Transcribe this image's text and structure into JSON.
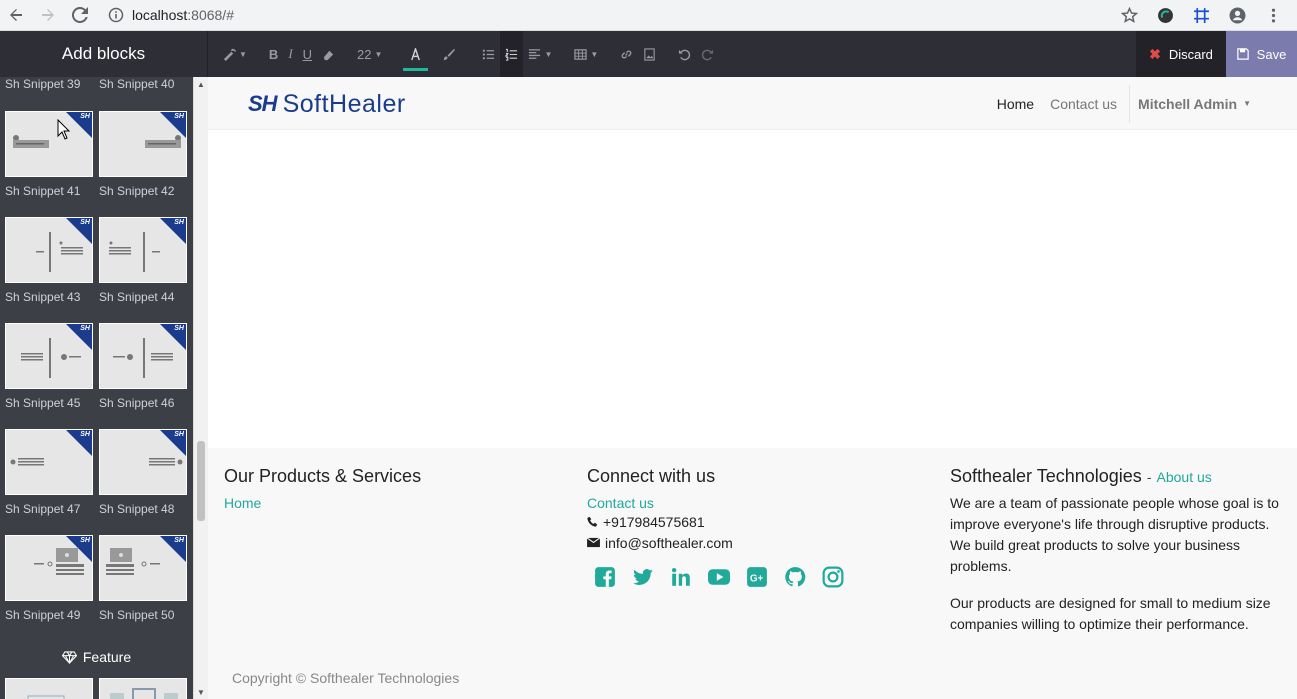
{
  "browser": {
    "url_host": "localhost",
    "url_rest": ":8068/#"
  },
  "editor": {
    "panel_title": "Add blocks",
    "font_size": "22",
    "discard_label": "Discard",
    "save_label": "Save"
  },
  "snippets": {
    "top_labels": [
      "Sh Snippet 39",
      "Sh Snippet 40"
    ],
    "rows": [
      {
        "left": "Sh Snippet 41",
        "right": "Sh Snippet 42"
      },
      {
        "left": "Sh Snippet 43",
        "right": "Sh Snippet 44"
      },
      {
        "left": "Sh Snippet 45",
        "right": "Sh Snippet 46"
      },
      {
        "left": "Sh Snippet 47",
        "right": "Sh Snippet 48"
      },
      {
        "left": "Sh Snippet 49",
        "right": "Sh Snippet 50"
      }
    ],
    "badge": "SH",
    "feature_label": "Feature"
  },
  "site": {
    "logo_text": "SoftHealer",
    "logo_mark": "SH",
    "nav": {
      "home": "Home",
      "contact": "Contact us",
      "user": "Mitchell Admin"
    }
  },
  "footer": {
    "col1": {
      "title": "Our Products & Services",
      "link": "Home"
    },
    "col2": {
      "title": "Connect with us",
      "link": "Contact us",
      "phone": "+917984575681",
      "email": "info@softhealer.com",
      "social": [
        "facebook-icon",
        "twitter-icon",
        "linkedin-icon",
        "youtube-icon",
        "google-plus-icon",
        "github-icon",
        "instagram-icon"
      ]
    },
    "col3": {
      "title": "Softhealer Technologies",
      "dash": "-",
      "about": "About us",
      "p1": "We are a team of passionate people whose goal is to improve everyone's life through disruptive products. We build great products to solve your business problems.",
      "p2": "Our products are designed for small to medium size companies willing to optimize their performance."
    },
    "copyright": "Copyright © Softhealer Technologies"
  },
  "colors": {
    "accent": "#21a99a",
    "brand": "#1b3c8c",
    "editor_bg": "#2d2e36",
    "save_bg": "#7c7bad"
  }
}
